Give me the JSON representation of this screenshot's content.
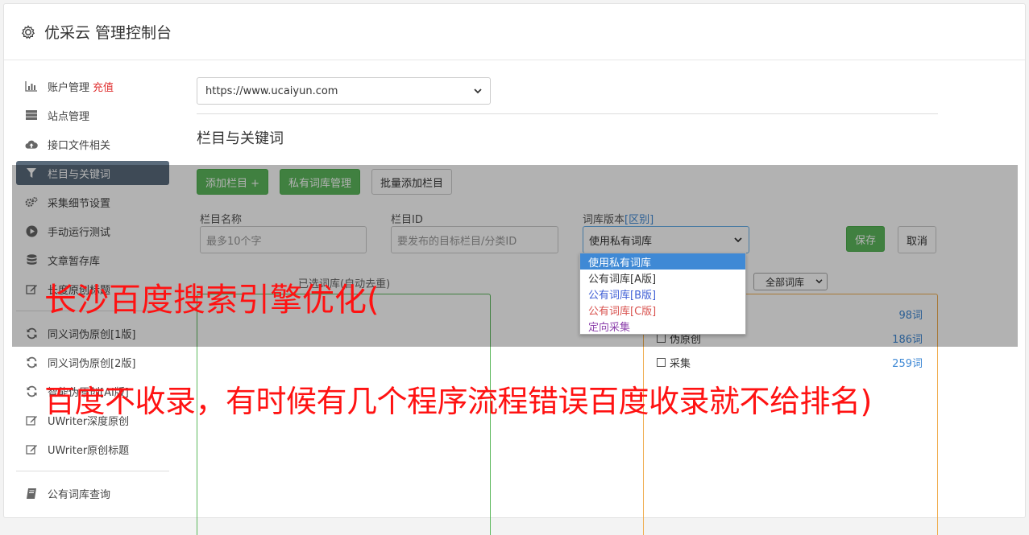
{
  "header": {
    "title": "优采云 管理控制台"
  },
  "sidebar": {
    "group1": [
      {
        "label": "账户管理",
        "extra": "充值",
        "icon": "bar-chart-icon"
      },
      {
        "label": "站点管理",
        "icon": "server-icon"
      },
      {
        "label": "接口文件相关",
        "icon": "cloud-upload-icon"
      },
      {
        "label": "栏目与关键词",
        "icon": "filter-icon",
        "active": true
      },
      {
        "label": "采集细节设置",
        "icon": "cogs-icon"
      },
      {
        "label": "手动运行测试",
        "icon": "play-circle-icon"
      },
      {
        "label": "文章暂存库",
        "icon": "database-icon"
      },
      {
        "label": "长度原创标题",
        "icon": "edit-icon"
      }
    ],
    "group2": [
      {
        "label": "同义词伪原创[1版]",
        "icon": "refresh-icon"
      },
      {
        "label": "同义词伪原创[2版]",
        "icon": "refresh-icon"
      },
      {
        "label": "智能伪原创[AI版]",
        "icon": "refresh-icon"
      },
      {
        "label": "UWriter深度原创",
        "icon": "edit-icon"
      },
      {
        "label": "UWriter原创标题",
        "icon": "edit-icon"
      }
    ],
    "group3": [
      {
        "label": "公有词库查询",
        "icon": "book-icon"
      }
    ]
  },
  "site_select": {
    "value": "https://www.ucaiyun.com"
  },
  "section": {
    "title": "栏目与关键词"
  },
  "toolbar": {
    "add_column": "添加栏目 +",
    "private_lib": "私有词库管理",
    "batch_add": "批量添加栏目"
  },
  "form": {
    "name_label": "栏目名称",
    "name_placeholder": "最多10个字",
    "id_label": "栏目ID",
    "id_placeholder": "要发布的目标栏目/分类ID",
    "version_label": "词库版本",
    "version_link": "[区别]",
    "version_value": "使用私有词库",
    "save": "保存",
    "cancel": "取消"
  },
  "dropdown": {
    "options": [
      {
        "label": "使用私有词库",
        "color": "#ffffff",
        "selected": true
      },
      {
        "label": "公有词库[A版]",
        "color": "#333333"
      },
      {
        "label": "公有词库[B版]",
        "color": "#3f5fd5"
      },
      {
        "label": "公有词库[C版]",
        "color": "#d9534f"
      },
      {
        "label": "定向采集",
        "color": "#8e44ad"
      }
    ]
  },
  "panels": {
    "left_caption": "已选词库(自动去重)",
    "filter_value": "全部词库",
    "libs": [
      {
        "label": "",
        "count": "98词"
      },
      {
        "label": "伪原创",
        "count": "186词"
      },
      {
        "label": "采集",
        "count": "259词"
      }
    ]
  },
  "watermark": {
    "line1": "长沙百度搜索引擎优化(",
    "line2": "百度不收录，有时候有几个程序流程错误百度收录就不给排名)"
  }
}
